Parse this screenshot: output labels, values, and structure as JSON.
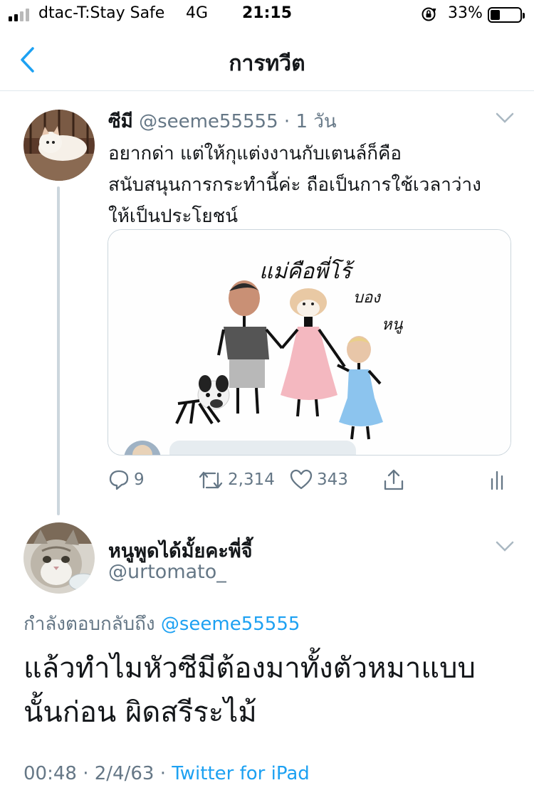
{
  "status_bar": {
    "carrier": "dtac-T:Stay Safe",
    "network": "4G",
    "time": "21:15",
    "battery": "33%",
    "battery_level": 0.33
  },
  "nav": {
    "title": "การทวีต",
    "back_icon": "chevron-left-icon"
  },
  "tweet": {
    "name": "ซีมี",
    "handle": "@seeme55555",
    "separator": "·",
    "time_ago": "1 วัน",
    "text_lines": [
      "อยากด่า แต่ให้กุแต่งงานกับเตนล์ก็คือ",
      "สนับสนุนการกระทำนี้ค่ะ ถือเป็นการใช้เวลาว่าง",
      "ให้เป็นประโยชน์"
    ],
    "media": {
      "handwriting": [
        "แม่คือพี่โร้",
        "บอง",
        "หนู"
      ]
    },
    "actions": {
      "reply_count": "9",
      "retweet_count": "2,314",
      "like_count": "343"
    }
  },
  "reply": {
    "name": "หนูพูดได้มั้ยคะพี่จี้",
    "handle": "@urtomato_",
    "replying_prefix": "กำลังตอบกลับถึง",
    "replying_to": "@seeme55555",
    "text_lines": [
      "แล้วทำไมหัวซีมีต้องมาทั้งตัวหมาแบบ",
      "นั้นก่อน ผิดสรีระไม้"
    ],
    "time": "00:48",
    "separator": "·",
    "date": "2/4/63",
    "source": "Twitter for iPad"
  },
  "colors": {
    "link": "#1da1f2",
    "muted": "#657786",
    "divider": "#e1e8ed",
    "thread_line": "#ccd6dd"
  }
}
